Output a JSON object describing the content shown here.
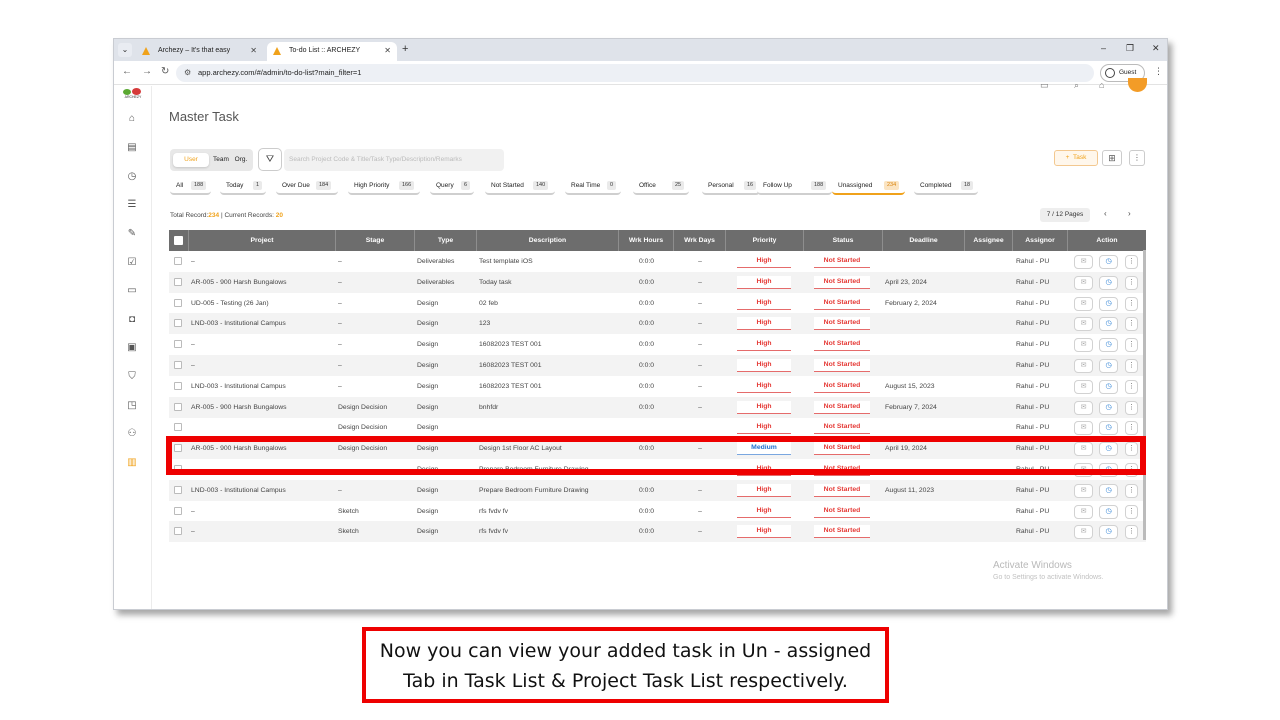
{
  "browser": {
    "tabs": [
      {
        "title": "Archezy – It's that easy"
      },
      {
        "title": "To-do List :: ARCHEZY"
      }
    ],
    "url": "app.archezy.com/#/admin/to-do-list?main_filter=1",
    "profile_label": "Guest"
  },
  "app": {
    "logo_text": "ARCHEZY",
    "page_title": "Master Task",
    "scope_toggle": {
      "user": "User",
      "team": "Team",
      "org": "Org."
    },
    "search_placeholder": "Search Project Code & Title/Task Type/Description/Remarks",
    "add_task_label": "Task",
    "filters": [
      {
        "label": "All",
        "count": "188"
      },
      {
        "label": "Today",
        "count": "1"
      },
      {
        "label": "Over Due",
        "count": "184"
      },
      {
        "label": "High Priority",
        "count": "166"
      },
      {
        "label": "Query",
        "count": "6"
      },
      {
        "label": "Not Started",
        "count": "140"
      },
      {
        "label": "Real Time",
        "count": "0"
      },
      {
        "label": "Office",
        "count": "25"
      },
      {
        "label": "Personal",
        "count": "16"
      },
      {
        "label": "Follow Up",
        "count": "188"
      },
      {
        "label": "Unassigned",
        "count": "234"
      },
      {
        "label": "Completed",
        "count": "18"
      }
    ],
    "active_filter": "Unassigned",
    "records": {
      "total_label": "Total Record:",
      "total": "234",
      "current_label": " | Current Records: ",
      "current": "20"
    },
    "pagination": "7 / 12 Pages",
    "columns": [
      "Project",
      "Stage",
      "Type",
      "Description",
      "Wrk Hours",
      "Wrk Days",
      "Priority",
      "Status",
      "Deadline",
      "Assignee",
      "Assignor",
      "Action"
    ],
    "rows": [
      {
        "project": "–",
        "stage": "–",
        "type": "Deliverables",
        "description": "Test template iOS",
        "hours": "0:0:0",
        "days": "–",
        "priority": "High",
        "status": "Not Started",
        "deadline": "",
        "assignee": "",
        "assignor": "Rahul - PU"
      },
      {
        "project": "AR-005 - 900 Harsh Bungalows",
        "stage": "–",
        "type": "Deliverables",
        "description": "Today task",
        "hours": "0:0:0",
        "days": "–",
        "priority": "High",
        "status": "Not Started",
        "deadline": "April 23, 2024",
        "assignee": "",
        "assignor": "Rahul - PU"
      },
      {
        "project": "UD-005 - Testing (26 Jan)",
        "stage": "–",
        "type": "Design",
        "description": "02 feb",
        "hours": "0:0:0",
        "days": "–",
        "priority": "High",
        "status": "Not Started",
        "deadline": "February 2, 2024",
        "assignee": "",
        "assignor": "Rahul - PU"
      },
      {
        "project": "LND-003 - Institutional Campus",
        "stage": "–",
        "type": "Design",
        "description": "123",
        "hours": "0:0:0",
        "days": "–",
        "priority": "High",
        "status": "Not Started",
        "deadline": "",
        "assignee": "",
        "assignor": "Rahul - PU"
      },
      {
        "project": "–",
        "stage": "–",
        "type": "Design",
        "description": "16082023 TEST 001",
        "hours": "0:0:0",
        "days": "–",
        "priority": "High",
        "status": "Not Started",
        "deadline": "",
        "assignee": "",
        "assignor": "Rahul - PU"
      },
      {
        "project": "–",
        "stage": "–",
        "type": "Design",
        "description": "16082023 TEST 001",
        "hours": "0:0:0",
        "days": "–",
        "priority": "High",
        "status": "Not Started",
        "deadline": "",
        "assignee": "",
        "assignor": "Rahul - PU"
      },
      {
        "project": "LND-003 - Institutional Campus",
        "stage": "–",
        "type": "Design",
        "description": "16082023 TEST 001",
        "hours": "0:0:0",
        "days": "–",
        "priority": "High",
        "status": "Not Started",
        "deadline": "August 15, 2023",
        "assignee": "",
        "assignor": "Rahul - PU"
      },
      {
        "project": "AR-005 - 900 Harsh Bungalows",
        "stage": "Design Decision",
        "type": "Design",
        "description": "bnhfdr",
        "hours": "0:0:0",
        "days": "–",
        "priority": "High",
        "status": "Not Started",
        "deadline": "February 7, 2024",
        "assignee": "",
        "assignor": "Rahul - PU"
      },
      {
        "project": "",
        "stage": "Design Decision",
        "type": "Design",
        "description": "",
        "hours": "",
        "days": "",
        "priority": "High",
        "status": "Not Started",
        "deadline": "",
        "assignee": "",
        "assignor": "Rahul - PU"
      },
      {
        "project": "AR-005 - 900 Harsh Bungalows",
        "stage": "Design Decision",
        "type": "Design",
        "description": "Design 1st Floor AC Layout",
        "hours": "0:0:0",
        "days": "–",
        "priority": "Medium",
        "status": "Not Started",
        "deadline": "April 19, 2024",
        "assignee": "",
        "assignor": "Rahul - PU"
      },
      {
        "project": "",
        "stage": "",
        "type": "Design",
        "description": "Prepare Bedroom Furniture Drawing",
        "hours": "",
        "days": "",
        "priority": "High",
        "status": "Not Started",
        "deadline": "",
        "assignee": "",
        "assignor": "Rahul - PU"
      },
      {
        "project": "LND-003 - Institutional Campus",
        "stage": "–",
        "type": "Design",
        "description": "Prepare Bedroom Furniture Drawing",
        "hours": "0:0:0",
        "days": "–",
        "priority": "High",
        "status": "Not Started",
        "deadline": "August 11, 2023",
        "assignee": "",
        "assignor": "Rahul - PU"
      },
      {
        "project": "–",
        "stage": "Sketch",
        "type": "Design",
        "description": "rfs fvdv fv",
        "hours": "0:0:0",
        "days": "–",
        "priority": "High",
        "status": "Not Started",
        "deadline": "",
        "assignee": "",
        "assignor": "Rahul - PU"
      },
      {
        "project": "–",
        "stage": "Sketch",
        "type": "Design",
        "description": "rfs fvdv fv",
        "hours": "0:0:0",
        "days": "–",
        "priority": "High",
        "status": "Not Started",
        "deadline": "",
        "assignee": "",
        "assignor": "Rahul - PU"
      }
    ],
    "watermark": {
      "line1": "Activate Windows",
      "line2": "Go to Settings to activate Windows."
    }
  },
  "caption": {
    "line1": "Now you can view your added task in Un - assigned",
    "line2": "Tab in Task List & Project Task List respectively."
  },
  "colors": {
    "accent": "#f0a21b",
    "highlight_border": "#ee0000",
    "priority_high": "#e53935",
    "priority_medium": "#1e6fd0",
    "table_header": "#6d6d6d"
  }
}
